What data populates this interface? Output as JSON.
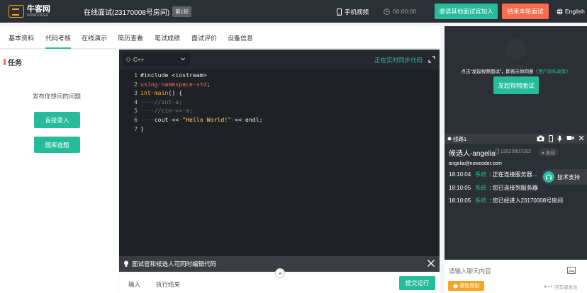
{
  "header": {
    "logo_name": "牛客网",
    "logo_sub": "NOWCODER",
    "room_title": "在线面试(23170008号房间)",
    "round_badge": "第1轮",
    "mobile_video": "手机视频",
    "timer": "00:00:00",
    "invite_label": "邀请其他面试官加入",
    "end_label": "结束本轮面试",
    "language": "English"
  },
  "tabs": [
    {
      "label": "基本资料",
      "active": false
    },
    {
      "label": "代码考核",
      "active": true
    },
    {
      "label": "在线演示",
      "active": false
    },
    {
      "label": "简历查看",
      "active": false
    },
    {
      "label": "笔试成绩",
      "active": false
    },
    {
      "label": "面试评价",
      "active": false
    },
    {
      "label": "设备信息",
      "active": false
    }
  ],
  "task": {
    "title": "任务",
    "hint": "发布你想问的问题",
    "direct_entry": "直接录入",
    "bank_select": "题库选题"
  },
  "editor": {
    "language": "C++",
    "sync_status": "正在实时同步代码",
    "footer_note": "面试官和候选人可同时编辑代码",
    "bottom_tabs": [
      "输入",
      "执行结果"
    ],
    "submit_label": "提交运行"
  },
  "code_lines": [
    "1",
    "2",
    "3",
    "4",
    "5",
    "6",
    "7"
  ],
  "video": {
    "hint_prefix": "点击\"发起视频面试\"，即表示你同意",
    "hint_link": "《用户隐私政策》",
    "start_label": "发起视频面试"
  },
  "chat": {
    "line_label": "线路1",
    "candidate_name": "候选人-angelia",
    "candidate_phone": "13520807263",
    "status": "离线",
    "email": "angelia@nowcoder.com",
    "messages": [
      {
        "time": "18:10:04",
        "sender": "系统",
        "text": "正在连接服务器..."
      },
      {
        "time": "18:10:05",
        "sender": "系统",
        "text": "您已连接到服务器"
      },
      {
        "time": "18:10:05",
        "sender": "系统",
        "text": "您已经进入23170008号房间"
      }
    ],
    "support_label": "技术支持",
    "input_placeholder": "请输入聊天内容",
    "help_label": "获取帮助",
    "enter_send": "回车键发送"
  },
  "colors": {
    "accent": "#25bb9b",
    "danger": "#f96c4c",
    "warning": "#f5a623",
    "dark": "#2b2f36"
  }
}
